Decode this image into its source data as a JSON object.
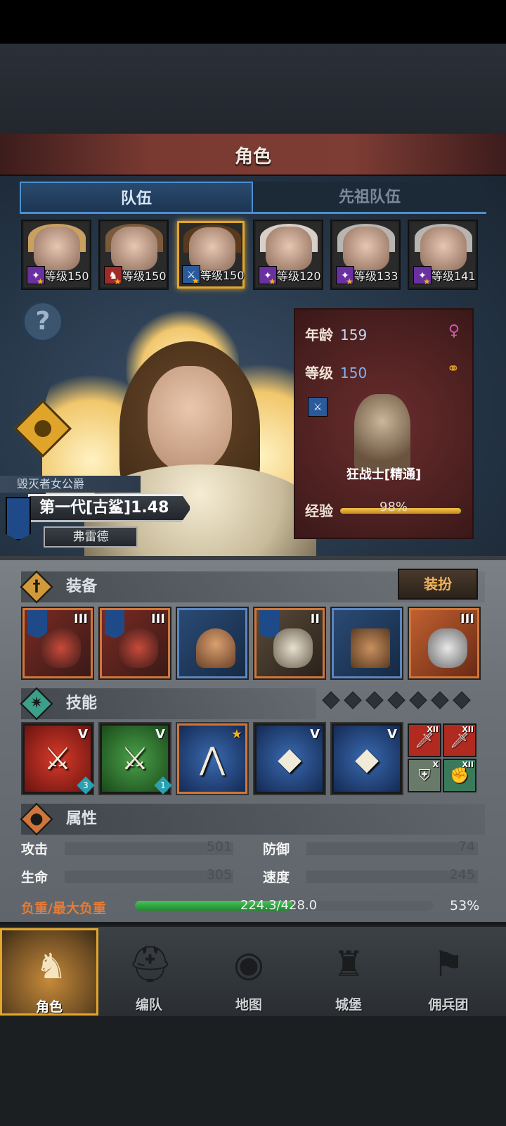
{
  "header": {
    "title": "角色"
  },
  "tabs": [
    {
      "label": "队伍"
    },
    {
      "label": "先祖队伍"
    }
  ],
  "team": [
    {
      "level": "等级150"
    },
    {
      "level": "等级150"
    },
    {
      "level": "等级150"
    },
    {
      "level": "等级120"
    },
    {
      "level": "等级133"
    },
    {
      "level": "等级141"
    }
  ],
  "character": {
    "title": "毁灭者女公爵",
    "name": "第一代[古鲨]1.48",
    "subname": "弗雷德",
    "age_label": "年龄",
    "age": "159",
    "level_label": "等级",
    "level": "150",
    "class_name": "狂战士[精通]",
    "exp_label": "经验",
    "exp_text": "98%",
    "exp_fraction": 0.98,
    "gender_icon": "female-icon"
  },
  "equipment": {
    "label": "装备",
    "dress_button": "装扮",
    "slots": [
      {
        "rank": "III"
      },
      {
        "rank": "III"
      },
      {
        "rank": ""
      },
      {
        "rank": "II"
      },
      {
        "rank": ""
      },
      {
        "rank": "III"
      }
    ]
  },
  "skills": {
    "label": "技能",
    "items": [
      {
        "rank": "V",
        "count": "3"
      },
      {
        "rank": "V",
        "count": "1"
      },
      {
        "rank": "",
        "count": ""
      },
      {
        "rank": "V",
        "count": ""
      },
      {
        "rank": "V",
        "count": ""
      }
    ],
    "passives": [
      {
        "rank": "XII"
      },
      {
        "rank": "XII"
      },
      {
        "rank": "X"
      },
      {
        "rank": "XII"
      }
    ]
  },
  "attributes": {
    "label": "属性",
    "attack_label": "攻击",
    "attack": "501",
    "defense_label": "防御",
    "defense": "74",
    "hp_label": "生命",
    "hp": "305",
    "speed_label": "速度",
    "speed": "245",
    "load_label": "负重/最大负重",
    "load_text": "224.3/428.0",
    "load_pct": "53%",
    "load_fraction": 0.53
  },
  "nav": [
    {
      "label": "角色"
    },
    {
      "label": "编队"
    },
    {
      "label": "地图"
    },
    {
      "label": "城堡"
    },
    {
      "label": "佣兵团"
    }
  ],
  "colors": {
    "accent_gold": "#e3a52a",
    "tab_blue": "#4d8fd0",
    "load_green": "#48c25a",
    "load_label": "#e87a34"
  }
}
